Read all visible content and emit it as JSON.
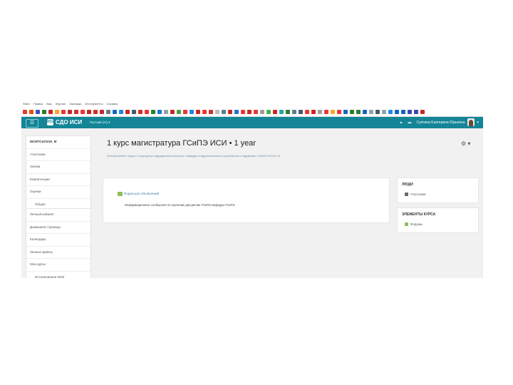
{
  "menubar": [
    "Файл",
    "Правка",
    "Вид",
    "Журнал",
    "Закладки",
    "Инструменты",
    "Справка"
  ],
  "bookmark_colors": [
    "#e53935",
    "#e65100",
    "#3f51b5",
    "#2e7d32",
    "#c62828",
    "#f9a825",
    "#e53935",
    "#c62828",
    "#d32f2f",
    "#e53935",
    "#c62828",
    "#d32f2f",
    "#c62828",
    "#607d8b",
    "#1565c0",
    "#1e88e5",
    "#c62828",
    "#455a64",
    "#d32f2f",
    "#e53935",
    "#2e7d32",
    "#1976d2",
    "#90a4ae",
    "#c62828",
    "#43a047",
    "#e53935",
    "#1e88e5",
    "#c62828",
    "#e53935",
    "#d32f2f",
    "#bdbdbd",
    "#607d8b",
    "#c62828",
    "#1976d2",
    "#e53935",
    "#c62828",
    "#e53935",
    "#9e9e9e",
    "#4caf50",
    "#c62828",
    "#26a69a",
    "#2e7d32",
    "#607d8b",
    "#455a64",
    "#e53935",
    "#c62828",
    "#9e9e9e",
    "#e53935",
    "#f9a825",
    "#e53935",
    "#1565c0",
    "#2e7d32",
    "#2e7d32",
    "#1565c0",
    "#90a4ae",
    "#455a64",
    "#90a4ae",
    "#1e88e5",
    "#1565c0",
    "#1565c0",
    "#3949ab",
    "#3949ab",
    "#c62828"
  ],
  "navbar": {
    "menu_icon": "hamburger-icon",
    "logo_mark": "ИСИ",
    "site_name": "СДО ИСИ",
    "language": "Русский (ru) ▾",
    "bell_icon": "bell-icon",
    "chat_icon": "chat-icon",
    "user_name": "Суятина Екатерина Юрьевна",
    "accent": "#138596"
  },
  "sidebar_top": [
    {
      "label": "МСМТСиПЭ1К_М",
      "head": true
    },
    {
      "label": "Участники"
    },
    {
      "label": "Значки"
    },
    {
      "label": "Компетенции"
    },
    {
      "label": "Оценки"
    },
    {
      "label": "Общее",
      "indent": true
    }
  ],
  "sidebar_bottom": [
    {
      "label": "Личный кабинет"
    },
    {
      "label": "Домашняя страница"
    },
    {
      "label": "Календарь"
    },
    {
      "label": "Личные файлы"
    },
    {
      "label": "Мои курсы"
    },
    {
      "label": "Исследование ИСИ",
      "indent": true
    }
  ],
  "page": {
    "title": "1 курс магистратура ГСиПЭ ИСИ • 1 year",
    "gear": "⚙ ▾",
    "breadcrumb": "Личный кабинет / Курсы / Структурные подразделения института / Кафедра «Гидротехническое строительство и гидравлика» / МСМТСиПЭ1К_М"
  },
  "main": {
    "forum_link": "Форум для объявлений",
    "forum_desc": "Информационные сообщения по изучению дисциплин ГСиПЭ кафедры ГСиПЭ"
  },
  "blocks": {
    "people": {
      "title": "ЛЮДИ",
      "item": "Участники"
    },
    "activities": {
      "title": "ЭЛЕМЕНТЫ КУРСА",
      "item": "Форумы"
    }
  }
}
